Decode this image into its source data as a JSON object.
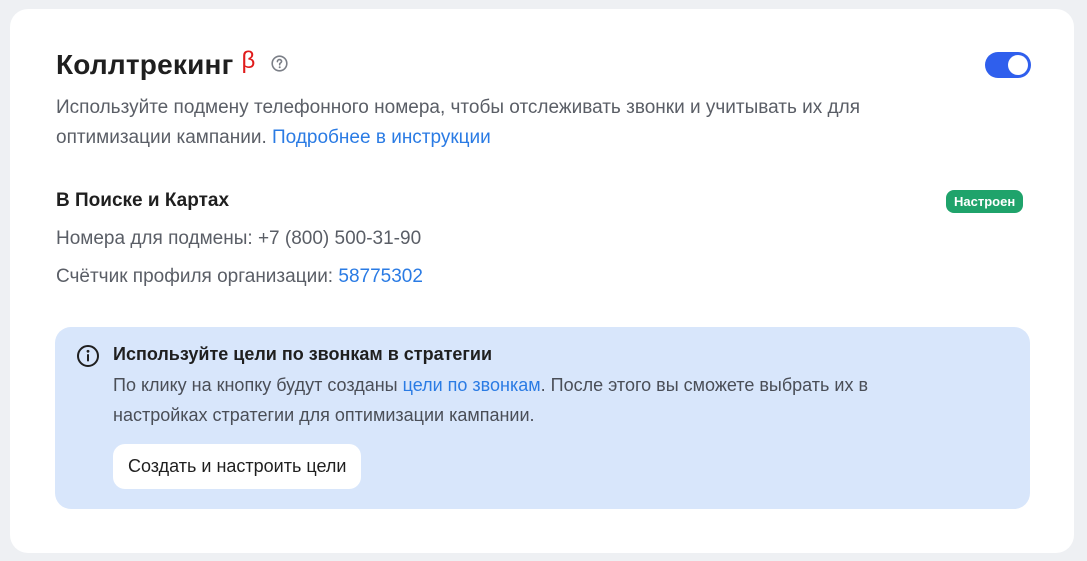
{
  "header": {
    "title": "Коллтрекинг",
    "beta_label": "β",
    "help_icon": "question-circle-icon",
    "toggle_state": "on"
  },
  "description": {
    "text": "Используйте подмену телефонного номера, чтобы отслеживать звонки и учитывать их для оптимизации кампании. ",
    "link_text": "Подробнее в инструкции"
  },
  "search_maps": {
    "title": "В Поиске и Картах",
    "status_badge": "Настроен",
    "numbers_label": "Номера для подмены: ",
    "numbers_value": "+7 (800) 500-31-90",
    "counter_label": "Счётчик профиля организации: ",
    "counter_value": "58775302"
  },
  "notice": {
    "icon": "info-circle-icon",
    "title": "Используйте цели по звонкам в стратегии",
    "text_before": "По клику на кнопку будут созданы ",
    "link_text": "цели по звонкам",
    "text_after": ". После этого вы сможете выбрать их в настройках стратегии для оптимизации кампании.",
    "button_label": "Создать и настроить цели"
  },
  "colors": {
    "accent": "#2f5fed",
    "link": "#2a7be4",
    "beta": "#e01b1b",
    "badge_bg": "#1fa36b",
    "notice_bg": "#d8e6fb"
  }
}
